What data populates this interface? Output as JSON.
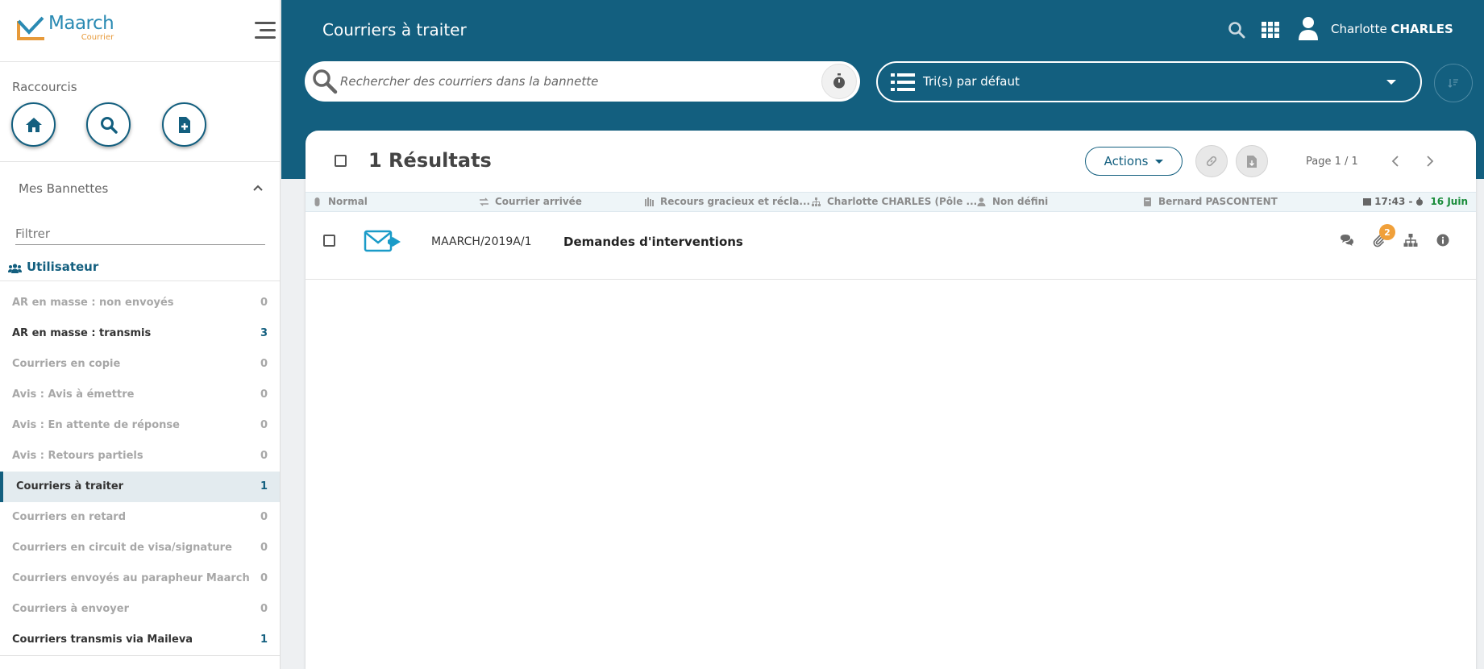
{
  "app": {
    "logo_name": "Maarch",
    "logo_sub": "Courrier"
  },
  "sidebar": {
    "shortcuts_title": "Raccourcis",
    "shortcuts": [
      {
        "icon": "home-icon"
      },
      {
        "icon": "search-icon"
      },
      {
        "icon": "new-document-icon"
      }
    ],
    "baskets_title": "Mes Bannettes",
    "filter_placeholder": "Filtrer",
    "group_label": "Utilisateur",
    "baskets": [
      {
        "label": "AR en masse : non envoyés",
        "count": "0",
        "state": "empty"
      },
      {
        "label": "AR en masse : transmis",
        "count": "3",
        "state": "active"
      },
      {
        "label": "Courriers en copie",
        "count": "0",
        "state": "empty"
      },
      {
        "label": "Avis : Avis à émettre",
        "count": "0",
        "state": "empty"
      },
      {
        "label": "Avis : En attente de réponse",
        "count": "0",
        "state": "empty"
      },
      {
        "label": "Avis : Retours partiels",
        "count": "0",
        "state": "empty"
      },
      {
        "label": "Courriers à traiter",
        "count": "1",
        "state": "selected"
      },
      {
        "label": "Courriers en retard",
        "count": "0",
        "state": "empty"
      },
      {
        "label": "Courriers en circuit de visa/signature",
        "count": "0",
        "state": "empty"
      },
      {
        "label": "Courriers envoyés au parapheur Maarch",
        "count": "0",
        "state": "empty"
      },
      {
        "label": "Courriers à envoyer",
        "count": "0",
        "state": "empty"
      },
      {
        "label": "Courriers transmis via Maileva",
        "count": "1",
        "state": "active"
      }
    ]
  },
  "header": {
    "title": "Courriers à traiter",
    "user_first": "Charlotte",
    "user_last": "CHARLES"
  },
  "toolbar": {
    "search_placeholder": "Rechercher des courriers dans la bannette",
    "sort_label": "Tri(s) par défaut"
  },
  "results": {
    "title": "1 Résultats",
    "actions_label": "Actions",
    "page_info": "Page 1 / 1"
  },
  "mail": {
    "priority": "Normal",
    "category": "Courrier arrivée",
    "doctype": "Recours gracieux et récla...",
    "destination": "Charlotte CHARLES (Pôle ...",
    "assignee": "Non défini",
    "contact": "Bernard PASCONTENT",
    "time": "17:43 -",
    "day": "16 Juin",
    "reference": "MAARCH/2019A/1",
    "subject": "Demandes d'interventions",
    "attachments_count": "2"
  },
  "colors": {
    "primary": "#135f7f",
    "accent_orange": "#f0a03a",
    "date_green": "#1a8c3a"
  }
}
